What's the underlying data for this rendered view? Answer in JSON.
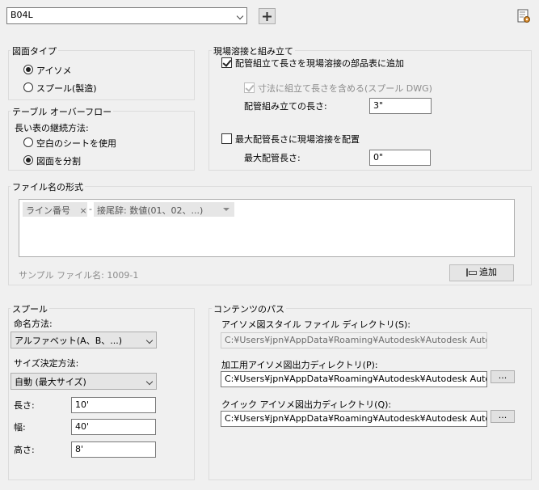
{
  "top": {
    "drawing_combo": "B04L",
    "add_icon": "plus-icon",
    "settings_icon": "document-gear-icon"
  },
  "drawing_type": {
    "title": "図面タイプ",
    "options": [
      "アイソメ",
      "スプール(製造)"
    ],
    "selected": 0
  },
  "table_overflow": {
    "title": "テーブル オーバーフロー",
    "method_label": "長い表の継続方法:",
    "options": [
      "空白のシートを使用",
      "図面を分割"
    ],
    "selected": 1
  },
  "field_weld": {
    "title": "現場溶接と組み立て",
    "add_length_label": "配管組立て長さを現場溶接の部品表に追加",
    "add_length_checked": true,
    "include_dim_label": "寸法に組立て長さを含める(スプール DWG)",
    "include_dim_checked": true,
    "assembly_length_label": "配管組み立ての長さ:",
    "assembly_length_value": "3\"",
    "place_weld_label": "最大配管長さに現場溶接を配置",
    "place_weld_checked": false,
    "max_length_label": "最大配管長さ:",
    "max_length_value": "0\""
  },
  "file_name_format": {
    "title": "ファイル名の形式",
    "tokens": [
      "ライン番号",
      "接尾辞:  数値(01、02、...)"
    ],
    "token_remove": "×",
    "separator": "-",
    "sample_label": "サンプル ファイル名: 1009-1",
    "add_button": "追加"
  },
  "spool": {
    "title": "スプール",
    "naming_label": "命名方法:",
    "naming_value": "アルファベット(A、B、...)",
    "size_label": "サイズ決定方法:",
    "size_value": "自動 (最大サイズ)",
    "length_label": "長さ:",
    "length_value": "10'",
    "width_label": "幅:",
    "width_value": "40'",
    "height_label": "高さ:",
    "height_value": "8'"
  },
  "content_path": {
    "title": "コンテンツのパス",
    "iso_style_label": "アイソメ図スタイル ファイル ディレクトリ(S):",
    "iso_style_value": "C:¥Users¥jpn¥AppData¥Roaming¥Autodesk¥Autodesk AutoCAD",
    "fab_output_label": "加工用アイソメ図出力ディレクトリ(P):",
    "fab_output_value": "C:¥Users¥jpn¥AppData¥Roaming¥Autodesk¥Autodesk AutoCAD",
    "quick_output_label": "クイック アイソメ図出力ディレクトリ(Q):",
    "quick_output_value": "C:¥Users¥jpn¥AppData¥Roaming¥Autodesk¥Autodesk AutoCAD",
    "browse_label": "..."
  }
}
